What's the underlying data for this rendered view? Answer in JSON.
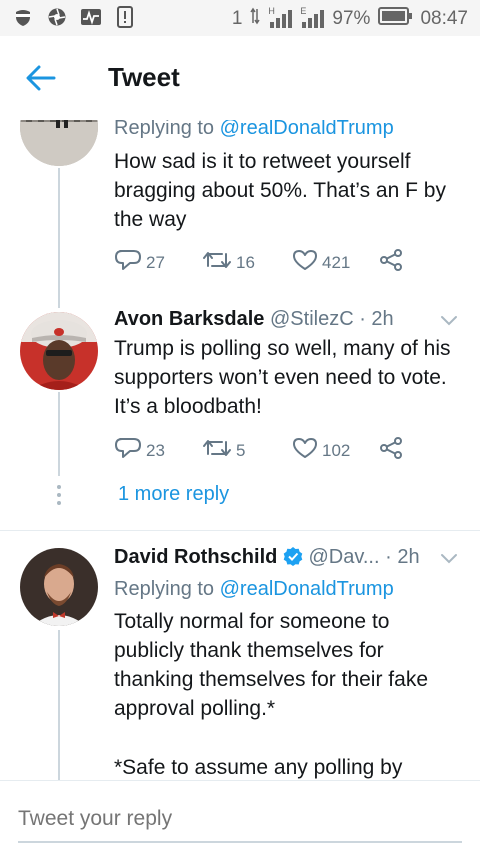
{
  "status_bar": {
    "network": "1",
    "signal_1": "H",
    "signal_2": "E",
    "battery": "97%",
    "time": "08:47"
  },
  "header": {
    "title": "Tweet"
  },
  "tweets": [
    {
      "reply_prefix": "Replying to",
      "reply_to": "@realDonaldTrump",
      "body": "How sad is it to retweet yourself bragging about 50%. That’s an F by the way",
      "replies": "27",
      "retweets": "16",
      "likes": "421"
    },
    {
      "name": "Avon Barksdale",
      "handle": "@StilezC",
      "time": "· 2h",
      "body": "Trump is polling so well, many of his supporters won’t even need to vote. It’s a bloodbath!",
      "replies": "23",
      "retweets": "5",
      "likes": "102",
      "more_replies": "1 more reply"
    },
    {
      "name": "David Rothschild",
      "handle": "@Dav...",
      "time": "· 2h",
      "reply_prefix": "Replying to",
      "reply_to": "@realDonaldTrump",
      "body": "Totally normal for someone to publicly thank themselves for thanking themselves for their fake approval polling.*",
      "body2": "*Safe to assume any polling by"
    }
  ],
  "compose": {
    "placeholder": "Tweet your reply"
  },
  "colors": {
    "accent": "#1b95e0",
    "muted": "#657786",
    "line": "#ccd6dd"
  }
}
